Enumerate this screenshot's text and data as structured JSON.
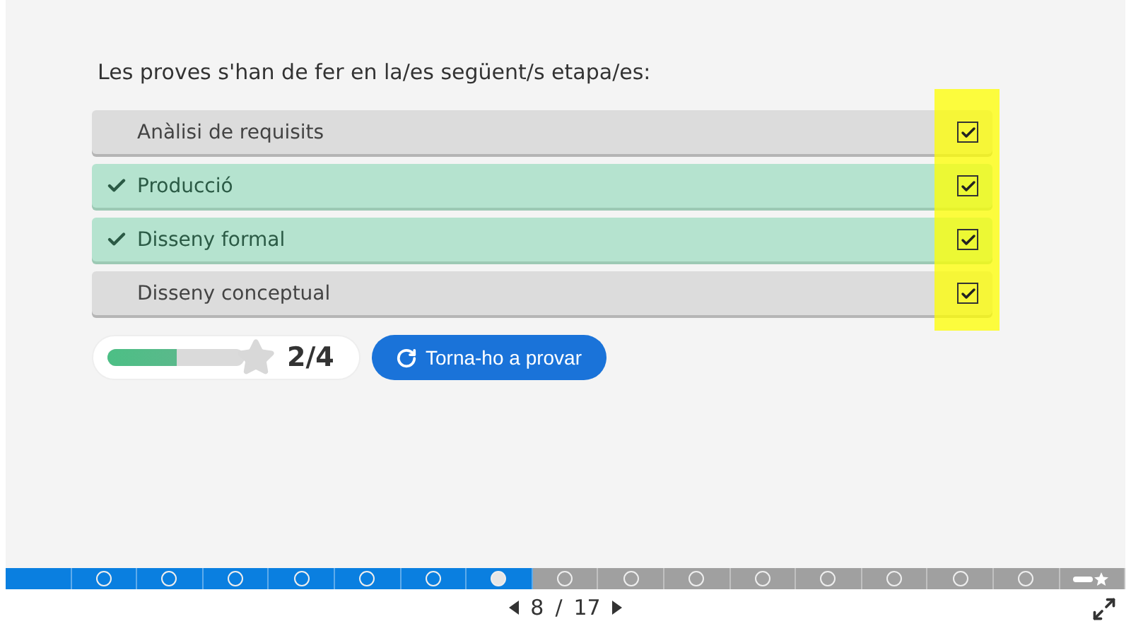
{
  "question": "Les proves s'han de fer en la/es següent/s etapa/es:",
  "options": [
    {
      "label": "Anàlisi de requisits",
      "correct": false,
      "checked": true
    },
    {
      "label": "Producció",
      "correct": true,
      "checked": true
    },
    {
      "label": "Disseny formal",
      "correct": true,
      "checked": true
    },
    {
      "label": "Disseny conceptual",
      "correct": false,
      "checked": true
    }
  ],
  "score": {
    "level": 0.5,
    "text": "2/4"
  },
  "retry_button": "Torna-ho a provar",
  "progress": [
    {
      "kind": "intro",
      "visited": true,
      "selected": false
    },
    {
      "kind": "step",
      "visited": true,
      "selected": false
    },
    {
      "kind": "step",
      "visited": true,
      "selected": false
    },
    {
      "kind": "step",
      "visited": true,
      "selected": false
    },
    {
      "kind": "step",
      "visited": true,
      "selected": false
    },
    {
      "kind": "step",
      "visited": true,
      "selected": false
    },
    {
      "kind": "step",
      "visited": true,
      "selected": false
    },
    {
      "kind": "step",
      "visited": true,
      "selected": true
    },
    {
      "kind": "step",
      "visited": false,
      "selected": false
    },
    {
      "kind": "step",
      "visited": false,
      "selected": false
    },
    {
      "kind": "step",
      "visited": false,
      "selected": false
    },
    {
      "kind": "step",
      "visited": false,
      "selected": false
    },
    {
      "kind": "step",
      "visited": false,
      "selected": false
    },
    {
      "kind": "step",
      "visited": false,
      "selected": false
    },
    {
      "kind": "step",
      "visited": false,
      "selected": false
    },
    {
      "kind": "step",
      "visited": false,
      "selected": false
    },
    {
      "kind": "score",
      "visited": false,
      "selected": false
    }
  ],
  "pager": {
    "current": "8",
    "separator": "/",
    "total": "17"
  }
}
